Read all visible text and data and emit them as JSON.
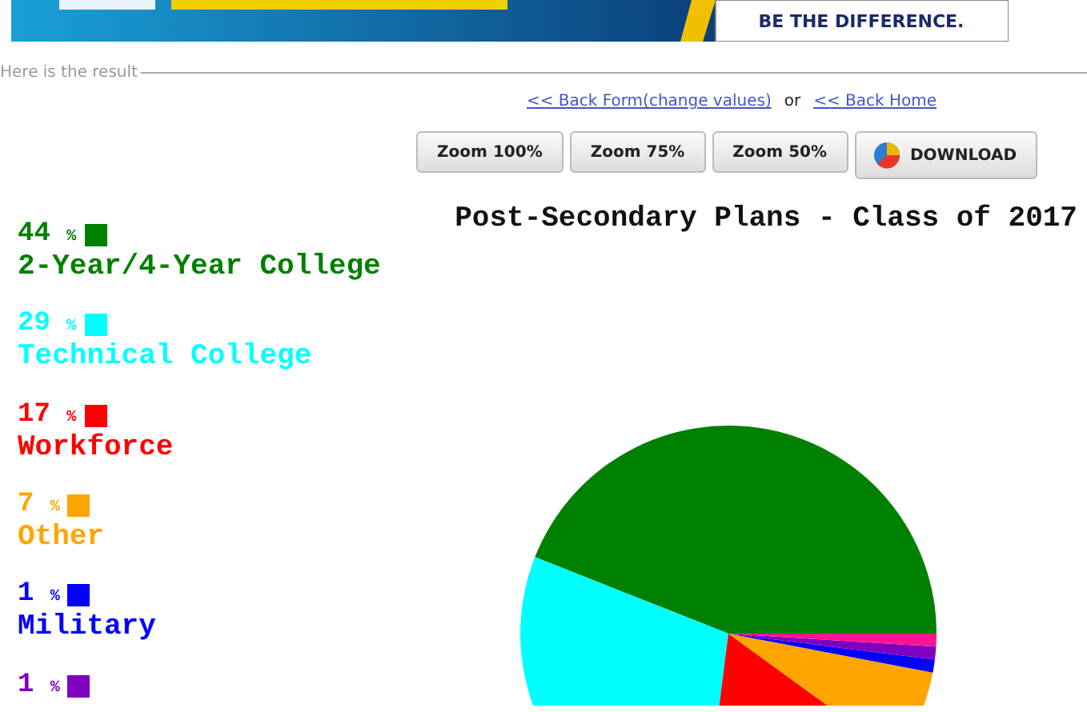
{
  "banner": {
    "kind": "picture",
    "text": "BE THE DIFFERENCE."
  },
  "result_heading": "Here is the result",
  "links": [
    {
      "kind": "link",
      "text": "<< Back Form(change values)"
    },
    {
      "kind": "sep",
      "text": "or"
    },
    {
      "kind": "link",
      "text": "<< Back Home"
    }
  ],
  "buttons": [
    {
      "label": "Zoom 100%",
      "kind": "plain"
    },
    {
      "label": "Zoom 75%",
      "kind": "plain"
    },
    {
      "label": "Zoom 50%",
      "kind": "plain"
    },
    {
      "label": "DOWNLOAD",
      "kind": "download"
    }
  ],
  "legend": [
    {
      "percent": "44",
      "unit": "%",
      "label": "2-Year/4-Year College",
      "color": "#008000"
    },
    {
      "percent": "29",
      "unit": "%",
      "label": "Technical College",
      "color": "#00ffff"
    },
    {
      "percent": "17",
      "unit": "%",
      "label": "Workforce",
      "color": "#ff0000"
    },
    {
      "percent": "7",
      "unit": "%",
      "label": "Other",
      "color": "#ffa500"
    },
    {
      "percent": "1",
      "unit": "%",
      "label": "Military",
      "color": "#0000ff"
    },
    {
      "percent": "1",
      "unit": "%",
      "color": "#8000c0"
    }
  ],
  "chart": {
    "chart_data": {
      "type": "pie",
      "title": "Post-Secondary Plans - Class of 2017",
      "values": [
        44,
        29,
        17,
        7,
        1,
        1,
        1
      ],
      "colors": [
        "#008000",
        "#00ffff",
        "#ff0000",
        "#ffa500",
        "#0000ff",
        "#8000c0",
        "#ff1493"
      ]
    }
  }
}
